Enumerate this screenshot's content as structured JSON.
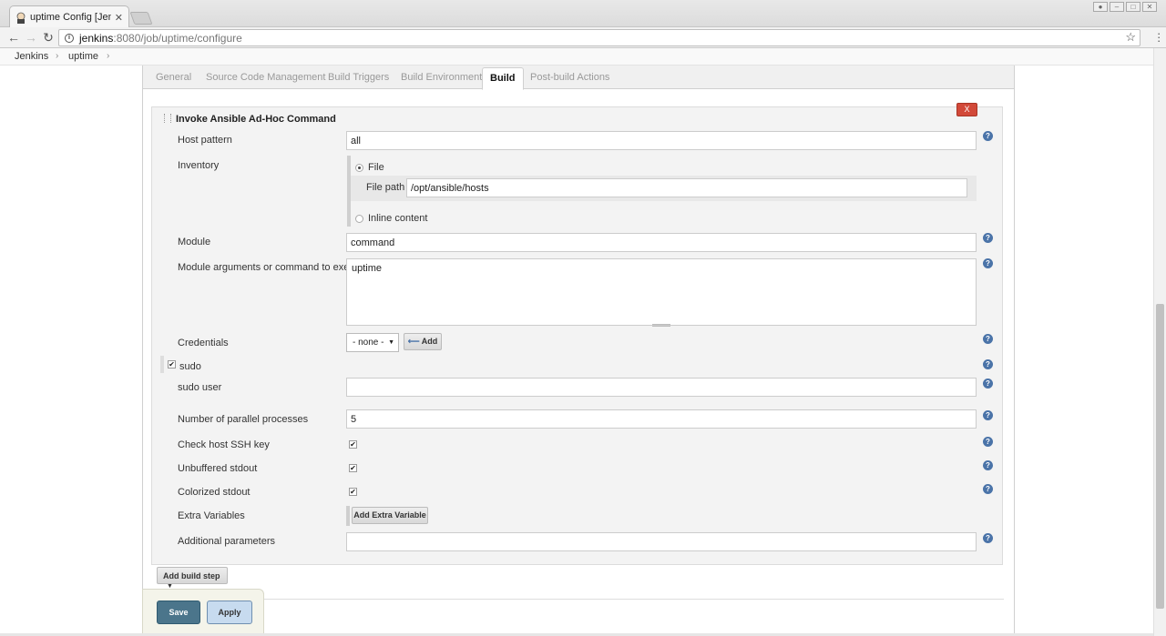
{
  "browser": {
    "tab_title": "uptime Config [Jenkins]",
    "url_host": "jenkins",
    "url_path": ":8080/job/uptime/configure"
  },
  "breadcrumb": [
    "Jenkins",
    "uptime"
  ],
  "config_tabs": [
    "General",
    "Source Code Management",
    "Build Triggers",
    "Build Environment",
    "Build",
    "Post-build Actions"
  ],
  "active_tab": "Build",
  "step": {
    "title": "Invoke Ansible Ad-Hoc Command",
    "delete_label": "X",
    "host_pattern_label": "Host pattern",
    "host_pattern_value": "all",
    "inventory_label": "Inventory",
    "inventory_file_option": "File",
    "file_path_label": "File path",
    "file_path_value": "/opt/ansible/hosts",
    "inventory_inline_option": "Inline content",
    "module_label": "Module",
    "module_value": "command",
    "module_args_label": "Module arguments or command to execute",
    "module_args_value": "uptime",
    "credentials_label": "Credentials",
    "credentials_value": "- none -",
    "add_credentials_label": "Add",
    "sudo_label": "sudo",
    "sudo_checked": true,
    "sudo_user_label": "sudo user",
    "sudo_user_value": "",
    "parallel_label": "Number of parallel processes",
    "parallel_value": "5",
    "check_ssh_label": "Check host SSH key",
    "unbuffered_label": "Unbuffered stdout",
    "colorized_label": "Colorized stdout",
    "extra_vars_label": "Extra Variables",
    "add_extra_var_label": "Add Extra Variable",
    "additional_params_label": "Additional parameters",
    "additional_params_value": ""
  },
  "add_build_step_label": "Add build step",
  "post_build_title_partial": "ns",
  "save_label": "Save",
  "apply_label": "Apply",
  "help_glyph": "?",
  "check_glyph": "✔",
  "colors": {
    "save_button": "#4b758b",
    "apply_button": "#c7dbef",
    "delete_button": "#d24939",
    "help_icon": "#4a73a8"
  }
}
